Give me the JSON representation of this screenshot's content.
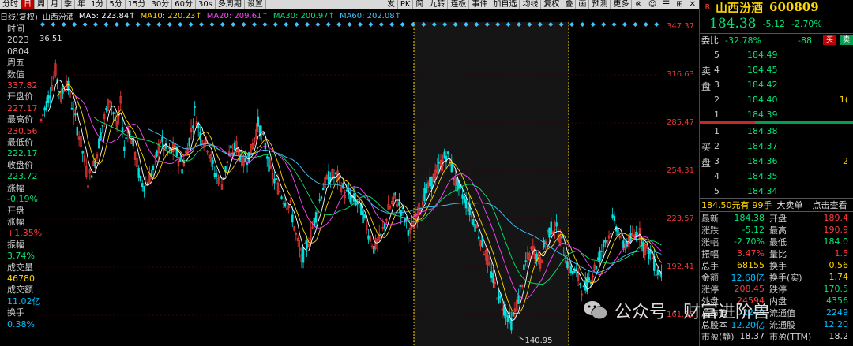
{
  "toolbar": {
    "left": [
      "分时",
      "日",
      "周",
      "月",
      "季",
      "年",
      "1分",
      "5分",
      "15分",
      "30分",
      "60分",
      "30s",
      "多周期",
      "设置"
    ],
    "active": 1,
    "right": [
      "发",
      "PK",
      "简",
      "九转",
      "连板",
      "事件",
      "加自选",
      "均线",
      "复权",
      "叠",
      "画",
      "预测",
      "更多"
    ]
  },
  "ma_legend": {
    "title": "日线(复权)",
    "name": "山西汾酒",
    "items": [
      {
        "label": "MA5: 223.84",
        "color": "#ffffff"
      },
      {
        "label": "MA10: 220.23",
        "color": "#ffd700"
      },
      {
        "label": "MA20: 209.61",
        "color": "#ff44ff"
      },
      {
        "label": "MA30: 200.97",
        "color": "#00e676"
      },
      {
        "label": "MA60: 202.08",
        "color": "#40c4ff"
      }
    ],
    "arrow": "↑"
  },
  "left_info": [
    {
      "t": "时间",
      "c": "#cccccc"
    },
    {
      "t": "2023",
      "c": "#cccccc"
    },
    {
      "t": "0804",
      "c": "#cccccc"
    },
    {
      "t": "周五",
      "c": "#cccccc"
    },
    {
      "t": "数值",
      "c": "#cccccc"
    },
    {
      "t": "337.82",
      "c": "#ff3b3b"
    },
    {
      "t": "开盘价",
      "c": "#cccccc"
    },
    {
      "t": "227.17",
      "c": "#ff3b3b"
    },
    {
      "t": "最高价",
      "c": "#cccccc"
    },
    {
      "t": "230.56",
      "c": "#ff3b3b"
    },
    {
      "t": "最低价",
      "c": "#cccccc"
    },
    {
      "t": "222.17",
      "c": "#00e676"
    },
    {
      "t": "收盘价",
      "c": "#cccccc"
    },
    {
      "t": "223.72",
      "c": "#00e676"
    },
    {
      "t": "涨幅",
      "c": "#cccccc"
    },
    {
      "t": "-0.19%",
      "c": "#00e676"
    },
    {
      "t": "开盘",
      "c": "#cccccc"
    },
    {
      "t": "涨幅",
      "c": "#cccccc"
    },
    {
      "t": "+1.35%",
      "c": "#ff3b3b"
    },
    {
      "t": "振幅",
      "c": "#cccccc"
    },
    {
      "t": "3.74%",
      "c": "#00e676"
    },
    {
      "t": "成交量",
      "c": "#cccccc"
    },
    {
      "t": "46780",
      "c": "#ffd700"
    },
    {
      "t": "成交额",
      "c": "#cccccc"
    },
    {
      "t": "11.02亿",
      "c": "#00bfff"
    },
    {
      "t": "换手",
      "c": "#cccccc"
    },
    {
      "t": "0.38%",
      "c": "#00bfff"
    }
  ],
  "top_price_label": "36.51",
  "low_label": "140.95",
  "y_ticks": [
    "347.37",
    "316.63",
    "285.47",
    "254.31",
    "223.57",
    "192.41",
    "161.25"
  ],
  "chart_data": {
    "type": "candlestick",
    "ylim": [
      140.95,
      347.37
    ],
    "low_marker": 140.95,
    "series": [
      {
        "name": "MA5",
        "color": "#ffffff"
      },
      {
        "name": "MA10",
        "color": "#ffd700"
      },
      {
        "name": "MA20",
        "color": "#ff44ff"
      },
      {
        "name": "MA30",
        "color": "#00e676"
      },
      {
        "name": "MA60",
        "color": "#40c4ff"
      }
    ],
    "path": [
      [
        0,
        285
      ],
      [
        4,
        300
      ],
      [
        8,
        318
      ],
      [
        11,
        300
      ],
      [
        14,
        312
      ],
      [
        18,
        290
      ],
      [
        22,
        270
      ],
      [
        26,
        245
      ],
      [
        30,
        258
      ],
      [
        34,
        282
      ],
      [
        38,
        300
      ],
      [
        42,
        280
      ],
      [
        44,
        296
      ],
      [
        46,
        266
      ],
      [
        48,
        281
      ],
      [
        51,
        268
      ],
      [
        55,
        244
      ],
      [
        58,
        242
      ],
      [
        62,
        252
      ],
      [
        66,
        272
      ],
      [
        70,
        263
      ],
      [
        74,
        266
      ],
      [
        78,
        253
      ],
      [
        82,
        272
      ],
      [
        85,
        291
      ],
      [
        88,
        276
      ],
      [
        92,
        268
      ],
      [
        96,
        250
      ],
      [
        100,
        243
      ],
      [
        104,
        262
      ],
      [
        108,
        268
      ],
      [
        112,
        257
      ],
      [
        116,
        264
      ],
      [
        120,
        283
      ],
      [
        124,
        268
      ],
      [
        127,
        250
      ],
      [
        130,
        243
      ],
      [
        134,
        233
      ],
      [
        138,
        227
      ],
      [
        141,
        208
      ],
      [
        144,
        192
      ],
      [
        148,
        205
      ],
      [
        152,
        222
      ],
      [
        156,
        241
      ],
      [
        160,
        248
      ],
      [
        164,
        247
      ],
      [
        168,
        237
      ],
      [
        172,
        233
      ],
      [
        176,
        229
      ],
      [
        180,
        214
      ],
      [
        184,
        200
      ],
      [
        188,
        207
      ],
      [
        192,
        225
      ],
      [
        196,
        234
      ],
      [
        200,
        223
      ],
      [
        204,
        210
      ],
      [
        208,
        222
      ],
      [
        212,
        236
      ],
      [
        216,
        244
      ],
      [
        220,
        254
      ],
      [
        224,
        262
      ],
      [
        226,
        258
      ],
      [
        229,
        244
      ],
      [
        232,
        238
      ],
      [
        236,
        228
      ],
      [
        240,
        216
      ],
      [
        244,
        203
      ],
      [
        248,
        187
      ],
      [
        252,
        170
      ],
      [
        256,
        160
      ],
      [
        260,
        150
      ],
      [
        264,
        166
      ],
      [
        268,
        190
      ],
      [
        272,
        200
      ],
      [
        276,
        190
      ],
      [
        280,
        210
      ],
      [
        284,
        215
      ],
      [
        288,
        203
      ],
      [
        292,
        186
      ],
      [
        296,
        183
      ],
      [
        300,
        171
      ],
      [
        304,
        181
      ],
      [
        308,
        192
      ],
      [
        312,
        205
      ],
      [
        314,
        208
      ],
      [
        316,
        218
      ],
      [
        318,
        215
      ],
      [
        322,
        202
      ],
      [
        326,
        205
      ],
      [
        330,
        212
      ],
      [
        334,
        200
      ],
      [
        338,
        194
      ],
      [
        340,
        185
      ],
      [
        343,
        183
      ]
    ]
  },
  "right_panel": {
    "badge": "R",
    "name": "山西汾酒",
    "code": "600809",
    "price": "184.38",
    "change": "-5.12",
    "pct": "-2.70%",
    "weibi_label": "委比",
    "weibi_pct": "-32.78%",
    "weibi_diff": "-88",
    "buy_btn": "买",
    "sell_btn": "卖",
    "sell_side": "卖盘",
    "buy_side": "买盘",
    "asks": [
      {
        "n": "5",
        "p": "184.49"
      },
      {
        "n": "4",
        "p": "184.45"
      },
      {
        "n": "3",
        "p": "184.42"
      },
      {
        "n": "2",
        "p": "184.40",
        "vol": "1("
      },
      {
        "n": "1",
        "p": "184.39"
      }
    ],
    "bids": [
      {
        "n": "1",
        "p": "184.38"
      },
      {
        "n": "2",
        "p": "184.37"
      },
      {
        "n": "3",
        "p": "184.36",
        "vol": "2"
      },
      {
        "n": "4",
        "p": "184.35"
      },
      {
        "n": "5",
        "p": "184.34"
      }
    ],
    "tick": {
      "p": "184.50元有",
      "v": "99手",
      "a": "大卖单",
      "b": "点击查看"
    },
    "quotes": [
      {
        "l1": "最新",
        "v1": "184.38",
        "c1": "#00e676",
        "l2": "开盘",
        "v2": "189.4",
        "c2": "#ff3b3b"
      },
      {
        "l1": "涨跌",
        "v1": "-5.12",
        "c1": "#00e676",
        "l2": "最高",
        "v2": "190.9",
        "c2": "#ff3b3b"
      },
      {
        "l1": "涨幅",
        "v1": "-2.70%",
        "c1": "#00e676",
        "l2": "最低",
        "v2": "184.0",
        "c2": "#00e676"
      },
      {
        "l1": "振幅",
        "v1": "3.47%",
        "c1": "#ff3b3b",
        "l2": "量比",
        "v2": "1.5",
        "c2": "#ff3b3b"
      },
      {
        "l1": "总手",
        "v1": "68155",
        "c1": "#ffd700",
        "l2": "换手",
        "v2": "0.56",
        "c2": "#ffd700"
      },
      {
        "l1": "金额",
        "v1": "12.68亿",
        "c1": "#00bfff",
        "l2": "换手(实)",
        "v2": "1.74",
        "c2": "#ffd700"
      },
      {
        "l1": "涨停",
        "v1": "208.45",
        "c1": "#ff3b3b",
        "l2": "跌停",
        "v2": "170.5",
        "c2": "#00e676"
      },
      {
        "l1": "外盘",
        "v1": "24594",
        "c1": "#ff3b3b",
        "l2": "内盘",
        "v2": "4356",
        "c2": "#00e676"
      },
      {
        "l1": "总市值",
        "v1": "2249",
        "c1": "#00bfff",
        "l2": "流通值",
        "v2": "2249",
        "c2": "#00bfff"
      },
      {
        "l1": "总股本",
        "v1": "12.20亿",
        "c1": "#00bfff",
        "l2": "流通股",
        "v2": "12.20",
        "c2": "#00bfff"
      },
      {
        "l1": "市盈(静)",
        "v1": "18.37",
        "c1": "#ddd",
        "l2": "市盈(TTM)",
        "v2": "18.2",
        "c2": "#ddd"
      }
    ]
  },
  "watermark": {
    "text": "公众号 · 财富进阶兽"
  }
}
